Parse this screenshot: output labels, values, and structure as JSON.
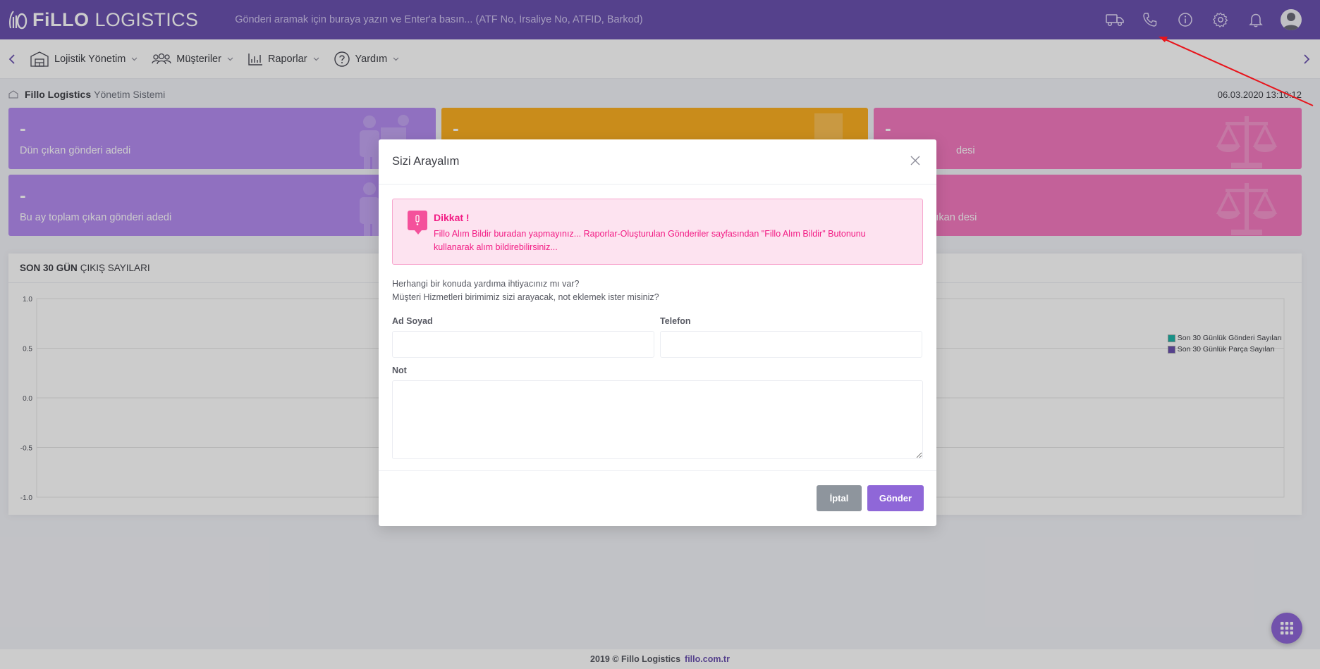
{
  "app": {
    "logo_bold": "FiLLO",
    "logo_light": "LOGISTICS"
  },
  "search": {
    "placeholder": "Gönderi aramak için buraya yazın ve Enter'a basın... (ATF No, İrsaliye No, ATFID, Barkod)"
  },
  "top_icons": [
    "truck-icon",
    "phone-icon",
    "info-icon",
    "gear-icon",
    "bell-icon",
    "user-avatar"
  ],
  "nav": {
    "items": [
      {
        "label": "Lojistik Yönetim",
        "icon": "warehouse-icon"
      },
      {
        "label": "Müşteriler",
        "icon": "users-icon"
      },
      {
        "label": "Raporlar",
        "icon": "bar-chart-icon"
      },
      {
        "label": "Yardım",
        "icon": "help-circle-icon"
      }
    ]
  },
  "subheader": {
    "brand": "Fillo Logistics",
    "system": "Yönetim Sistemi",
    "datetime": "06.03.2020 13:10:12"
  },
  "cards": [
    {
      "value": "-",
      "label": "Dün çıkan gönderi adedi",
      "color": "#b48cf0"
    },
    {
      "value": "-",
      "label": "",
      "color": "#fcaf22"
    },
    {
      "value": "-",
      "label": "desi",
      "color": "#f47ac0"
    },
    {
      "value": "-",
      "label": "Bu ay toplam çıkan gönderi adedi",
      "color": "#b48cf0"
    },
    {
      "value": "",
      "label": "",
      "color": "#fcaf22"
    },
    {
      "value": "",
      "label": "m çıkan desi",
      "color": "#f47ac0"
    }
  ],
  "chart_section": {
    "title_bold": "SON 30 GÜN",
    "title_rest": "ÇIKIŞ SAYILARI"
  },
  "chart_data": {
    "type": "line",
    "title": "",
    "xlabel": "",
    "ylabel": "",
    "ylim": [
      -1.0,
      1.0
    ],
    "yticks": [
      "1.0",
      "0.5",
      "0.0",
      "-0.5",
      "-1.0"
    ],
    "grid": true,
    "legend_position": "top-right",
    "series": [
      {
        "name": "Son 30 Günlük Gönderi Sayıları",
        "values": [],
        "color": "#1fb5a8"
      },
      {
        "name": "Son 30 Günlük Parça Sayıları",
        "values": [],
        "color": "#6b52b0"
      }
    ]
  },
  "modal": {
    "title": "Sizi Arayalım",
    "alert_title": "Dikkat !",
    "alert_text": "Fillo Alım Bildir buradan yapmayınız... Raporlar-Oluşturulan Gönderiler sayfasından \"Fillo Alım Bildir\" Butonunu kullanarak alım bildirebilirsiniz...",
    "info_line1": "Herhangi bir konuda yardıma ihtiyacınız mı var?",
    "info_line2": "Müşteri Hizmetleri birimimiz sizi arayacak, not eklemek ister misiniz?",
    "name_label": "Ad Soyad",
    "name_value": "",
    "phone_label": "Telefon",
    "phone_value": "",
    "note_label": "Not",
    "note_value": "",
    "cancel_label": "İptal",
    "send_label": "Gönder"
  },
  "footer": {
    "copyright": "2019 © Fillo Logistics",
    "link": "fillo.com.tr"
  },
  "colors": {
    "topbar": "#6b52b0",
    "accent": "#8f67d8",
    "alert_text": "#f21c84",
    "alert_bg": "#fde3f0",
    "annotation_arrow": "#e8141b"
  }
}
